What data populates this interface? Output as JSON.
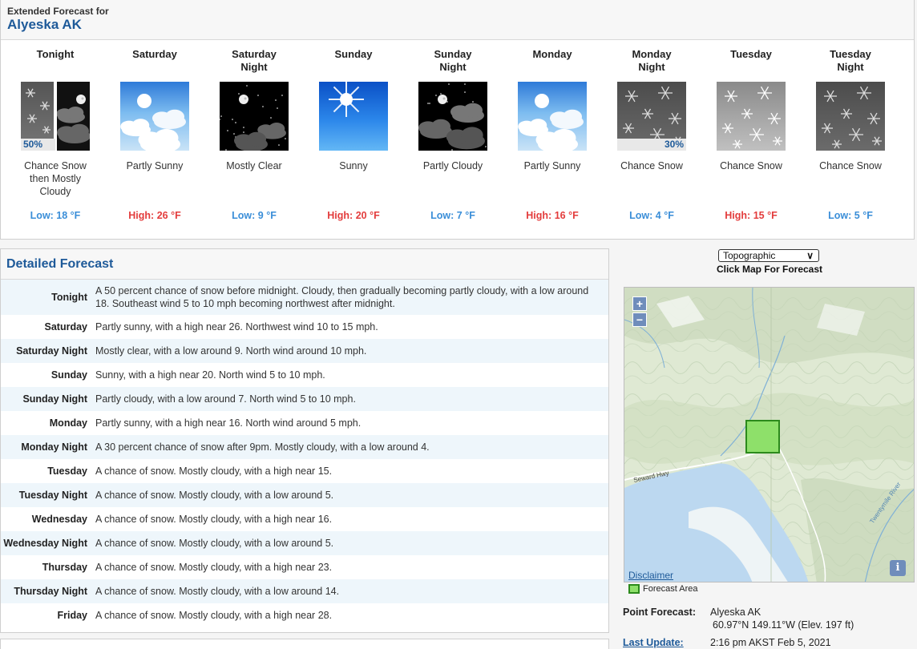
{
  "extended": {
    "label": "Extended Forecast for",
    "location": "Alyeska AK",
    "periods": [
      {
        "name_l1": "Tonight",
        "name_l2": "",
        "icon": "snow-then-mostly-cloudy-night",
        "pop": "50%",
        "desc": "Chance Snow then Mostly Cloudy",
        "temp": "Low: 18 °F",
        "temp_kind": "low"
      },
      {
        "name_l1": "Saturday",
        "name_l2": "",
        "icon": "partly-sunny",
        "pop": "",
        "desc": "Partly Sunny",
        "temp": "High: 26 °F",
        "temp_kind": "high"
      },
      {
        "name_l1": "Saturday",
        "name_l2": "Night",
        "icon": "mostly-clear-night",
        "pop": "",
        "desc": "Mostly Clear",
        "temp": "Low: 9 °F",
        "temp_kind": "low"
      },
      {
        "name_l1": "Sunday",
        "name_l2": "",
        "icon": "sunny",
        "pop": "",
        "desc": "Sunny",
        "temp": "High: 20 °F",
        "temp_kind": "high"
      },
      {
        "name_l1": "Sunday",
        "name_l2": "Night",
        "icon": "partly-cloudy-night",
        "pop": "",
        "desc": "Partly Cloudy",
        "temp": "Low: 7 °F",
        "temp_kind": "low"
      },
      {
        "name_l1": "Monday",
        "name_l2": "",
        "icon": "partly-sunny",
        "pop": "",
        "desc": "Partly Sunny",
        "temp": "High: 16 °F",
        "temp_kind": "high"
      },
      {
        "name_l1": "Monday",
        "name_l2": "Night",
        "icon": "chance-snow-night",
        "pop": "30%",
        "desc": "Chance Snow",
        "temp": "Low: 4 °F",
        "temp_kind": "low"
      },
      {
        "name_l1": "Tuesday",
        "name_l2": "",
        "icon": "chance-snow-day",
        "pop": "",
        "desc": "Chance Snow",
        "temp": "High: 15 °F",
        "temp_kind": "high"
      },
      {
        "name_l1": "Tuesday",
        "name_l2": "Night",
        "icon": "chance-snow-night",
        "pop": "",
        "desc": "Chance Snow",
        "temp": "Low: 5 °F",
        "temp_kind": "low"
      }
    ]
  },
  "detailed": {
    "title": "Detailed Forecast",
    "rows": [
      {
        "name": "Tonight",
        "text": "A 50 percent chance of snow before midnight. Cloudy, then gradually becoming partly cloudy, with a low around 18. Southeast wind 5 to 10 mph becoming northwest after midnight."
      },
      {
        "name": "Saturday",
        "text": "Partly sunny, with a high near 26. Northwest wind 10 to 15 mph."
      },
      {
        "name": "Saturday Night",
        "text": "Mostly clear, with a low around 9. North wind around 10 mph."
      },
      {
        "name": "Sunday",
        "text": "Sunny, with a high near 20. North wind 5 to 10 mph."
      },
      {
        "name": "Sunday Night",
        "text": "Partly cloudy, with a low around 7. North wind 5 to 10 mph."
      },
      {
        "name": "Monday",
        "text": "Partly sunny, with a high near 16. North wind around 5 mph."
      },
      {
        "name": "Monday Night",
        "text": "A 30 percent chance of snow after 9pm. Mostly cloudy, with a low around 4."
      },
      {
        "name": "Tuesday",
        "text": "A chance of snow. Mostly cloudy, with a high near 15."
      },
      {
        "name": "Tuesday Night",
        "text": "A chance of snow. Mostly cloudy, with a low around 5."
      },
      {
        "name": "Wednesday",
        "text": "A chance of snow. Mostly cloudy, with a high near 16."
      },
      {
        "name": "Wednesday Night",
        "text": "A chance of snow. Mostly cloudy, with a low around 5."
      },
      {
        "name": "Thursday",
        "text": "A chance of snow. Mostly cloudy, with a high near 23."
      },
      {
        "name": "Thursday Night",
        "text": "A chance of snow. Mostly cloudy, with a low around 14."
      },
      {
        "name": "Friday",
        "text": "A chance of snow. Mostly cloudy, with a high near 28."
      }
    ]
  },
  "map": {
    "layer_selected": "Topographic",
    "click_label": "Click Map For Forecast",
    "zoom_in": "+",
    "zoom_out": "−",
    "info": "i",
    "disclaimer": "Disclaimer",
    "legend": "Forecast Area",
    "road_label": "Seward Hwy",
    "river_label": "Twentymile River"
  },
  "point": {
    "label": "Point Forecast:",
    "name": "Alyeska AK",
    "coords": "60.97°N 149.11°W (Elev. 197 ft)",
    "update_label": "Last Update:",
    "update_value": "2:16 pm AKST Feb 5, 2021"
  },
  "colors": {
    "accent": "#1e5a99",
    "high_temp": "#e33c3c",
    "low_temp": "#3a8ed8",
    "forecast_area": "#8ee06a"
  }
}
